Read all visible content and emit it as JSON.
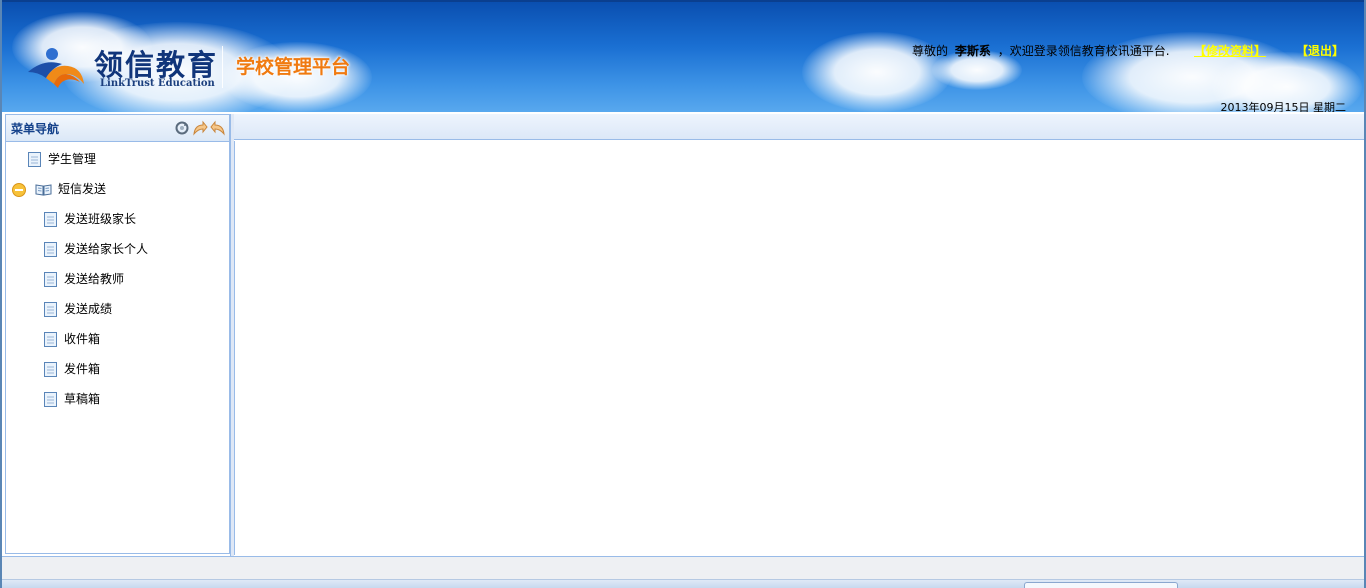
{
  "header": {
    "brand_cn": "领信教育",
    "brand_en": "LinkTrust Education",
    "platform_title": "学校管理平台",
    "welcome_prefix": "尊敬的",
    "username": "李斯系",
    "welcome_suffix": "，欢迎登录领信教育校讯通平台.",
    "edit_profile": "【修改资料】",
    "logout": "【退出】",
    "date": "2013年09月15日 星期二"
  },
  "sidebar": {
    "title": "菜单导航",
    "tools": [
      "refresh-icon",
      "forward-icon",
      "back-icon"
    ],
    "items": [
      {
        "label": "学生管理",
        "icon": "document-icon"
      },
      {
        "label": "短信发送",
        "icon": "open-book-icon",
        "expanded": true
      },
      {
        "label": "发送班级家长",
        "icon": "document-icon"
      },
      {
        "label": "发送给家长个人",
        "icon": "document-icon"
      },
      {
        "label": "发送给教师",
        "icon": "document-icon"
      },
      {
        "label": "发送成绩",
        "icon": "document-icon"
      },
      {
        "label": "收件箱",
        "icon": "document-icon"
      },
      {
        "label": "发件箱",
        "icon": "document-icon"
      },
      {
        "label": "草稿箱",
        "icon": "document-icon"
      }
    ]
  },
  "colors": {
    "banner_top": "#0a4fb0",
    "banner_bottom": "#58a8ee",
    "brand_navy": "#10357a",
    "platform_orange": "#f07a10",
    "link_yellow": "#ffff00",
    "panel_border": "#99bbe8"
  }
}
